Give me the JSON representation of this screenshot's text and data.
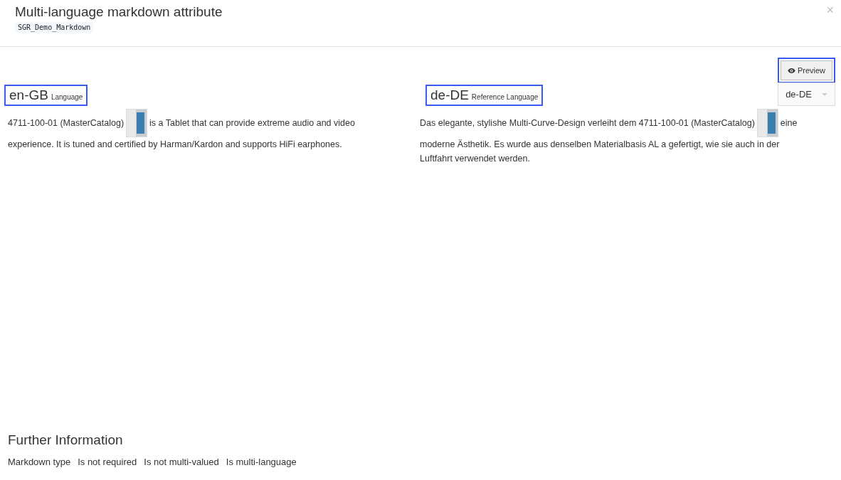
{
  "dialog": {
    "title": "Multi-language markdown attribute",
    "attribute_code": "SGR_Demo_Markdown",
    "close": "×"
  },
  "toolbar": {
    "preview_button": {
      "label": "Preview",
      "highlighted": true
    },
    "reference_select": {
      "value": "de-DE"
    }
  },
  "columns": [
    {
      "language": "en-GB",
      "role": "Language",
      "highlighted": true,
      "lines": [
        [
          {
            "kind": "text",
            "text": "4711-100-01 (MasterCatalog)"
          },
          {
            "kind": "image"
          },
          {
            "kind": "text",
            "text": "is a Tablet that can provide extreme audio and video"
          }
        ],
        [
          {
            "kind": "text",
            "text": "experience. It is tuned and certified by Harman/Kardon and supports HiFi earphones."
          }
        ]
      ]
    },
    {
      "language": "de-DE",
      "role": "Reference Language",
      "highlighted": true,
      "lines": [
        [
          {
            "kind": "text",
            "text": "Das elegante, stylishe Multi-Curve-Design verleiht dem 4711-100-01 (MasterCatalog)"
          },
          {
            "kind": "image"
          },
          {
            "kind": "text",
            "text": "eine"
          }
        ],
        [
          {
            "kind": "text",
            "text": "moderne Ästhetik. Es wurde aus denselben Materialbasis AL a gefertigt, wie sie auch in der"
          }
        ],
        [
          {
            "kind": "text",
            "text": "Luftfahrt verwendet werden."
          }
        ]
      ]
    }
  ],
  "further_information": {
    "title": "Further Information",
    "properties": [
      "Markdown type",
      "Is not required",
      "Is not multi-valued",
      "Is multi-language"
    ]
  }
}
